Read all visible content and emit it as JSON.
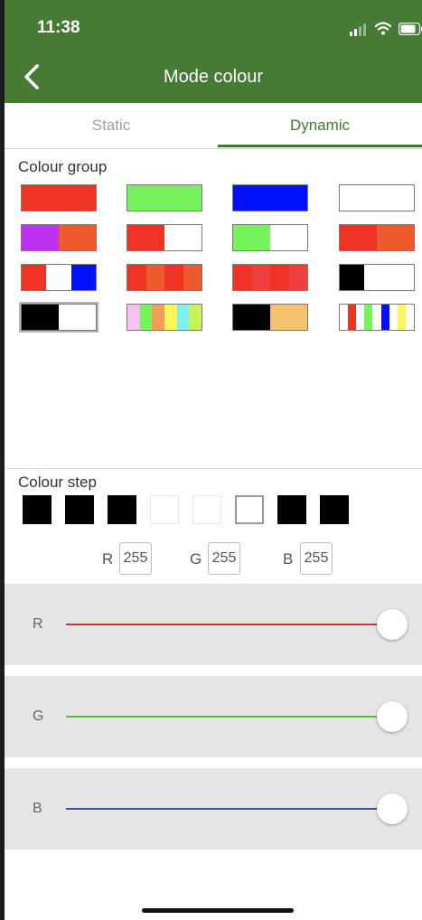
{
  "status": {
    "time": "11:38"
  },
  "header": {
    "title": "Mode colour"
  },
  "tabs": [
    {
      "label": "Static"
    },
    {
      "label": "Dynamic"
    }
  ],
  "colour_group": {
    "label": "Colour group",
    "swatches": [
      {
        "colors": [
          "#ee3224"
        ]
      },
      {
        "colors": [
          "#76f25a"
        ]
      },
      {
        "colors": [
          "#0010fa"
        ]
      },
      {
        "colors": [
          "#ffffff"
        ]
      },
      {
        "colors": [
          "#bd32ef",
          "#ee5a2d"
        ]
      },
      {
        "colors": [
          "#ee3224",
          "#ffffff"
        ]
      },
      {
        "colors": [
          "#76f25a",
          "#ffffff"
        ]
      },
      {
        "colors": [
          "#ee3224",
          "#ee5a2d"
        ]
      },
      {
        "colors": [
          "#ee3224",
          "#ffffff",
          "#0010fa"
        ]
      },
      {
        "colors": [
          "#ee3224",
          "#ee5a2d",
          "#ee3224",
          "#ee5a2d"
        ]
      },
      {
        "colors": [
          "#ee3224",
          "#ee3f3f",
          "#ee3224",
          "#ee3f3f"
        ]
      },
      {
        "colors": [
          "#000000",
          "#ffffff",
          "#ffffff"
        ]
      },
      {
        "colors": [
          "#000000",
          "#ffffff"
        ],
        "selected": true
      },
      {
        "colors": [
          "#f5c2f2",
          "#76f25a",
          "#f39d5a",
          "#fdf55a",
          "#7af2f2",
          "#c8f25a"
        ]
      },
      {
        "colors": [
          "#000000",
          "#000000",
          "#f6c26e",
          "#f6c26e"
        ]
      },
      {
        "colors": [
          "#ffffff",
          "#ee3224",
          "#ffffff",
          "#76f25a",
          "#ffffff",
          "#0010fa",
          "#ffffff",
          "#fdf55a",
          "#ffffff"
        ]
      }
    ]
  },
  "colour_step": {
    "label": "Colour step",
    "steps": [
      {
        "color": "#000000"
      },
      {
        "color": "#000000"
      },
      {
        "color": "#000000"
      },
      {
        "color": "#ffffff"
      },
      {
        "color": "#ffffff"
      },
      {
        "color": "#ffffff",
        "selected": true
      },
      {
        "color": "#000000"
      },
      {
        "color": "#000000"
      }
    ]
  },
  "rgb": {
    "r_label": "R",
    "r_value": "255",
    "g_label": "G",
    "g_value": "255",
    "b_label": "B",
    "b_value": "255"
  },
  "sliders": [
    {
      "label": "R",
      "value": 255,
      "max": 255,
      "color": "#c0393b"
    },
    {
      "label": "G",
      "value": 255,
      "max": 255,
      "color": "#6cb04a"
    },
    {
      "label": "B",
      "value": 255,
      "max": 255,
      "color": "#3356a8"
    }
  ]
}
